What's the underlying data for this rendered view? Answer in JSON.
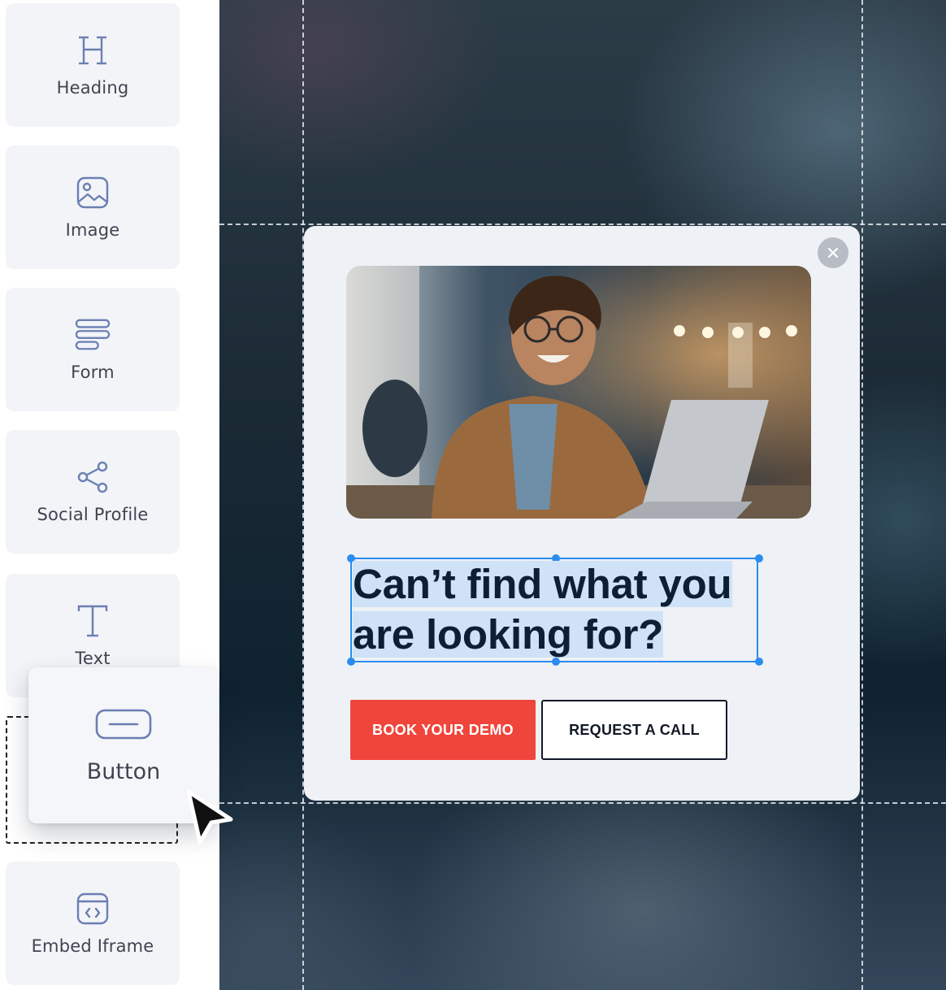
{
  "widgets": {
    "heading": {
      "label": "Heading",
      "icon": "heading-icon"
    },
    "image": {
      "label": "Image",
      "icon": "image-icon"
    },
    "form": {
      "label": "Form",
      "icon": "form-icon"
    },
    "social_profile": {
      "label": "Social Profile",
      "icon": "share-icon"
    },
    "text": {
      "label": "Text",
      "icon": "text-icon"
    },
    "button": {
      "label": "Button",
      "icon": "button-icon"
    },
    "embed_iframe": {
      "label": "Embed Iframe",
      "icon": "code-embed-icon"
    }
  },
  "popup": {
    "headline_line1": "Can’t find what you",
    "headline_line2": "are looking for?",
    "primary_button": "BOOK YOUR DEMO",
    "secondary_button": "REQUEST A CALL",
    "close_icon": "close-icon",
    "image": "photo of smiling man using laptop"
  },
  "colors": {
    "primary_button": "#f0453b",
    "selection": "#2b8cf0",
    "icon_stroke": "#6b7fb3"
  }
}
